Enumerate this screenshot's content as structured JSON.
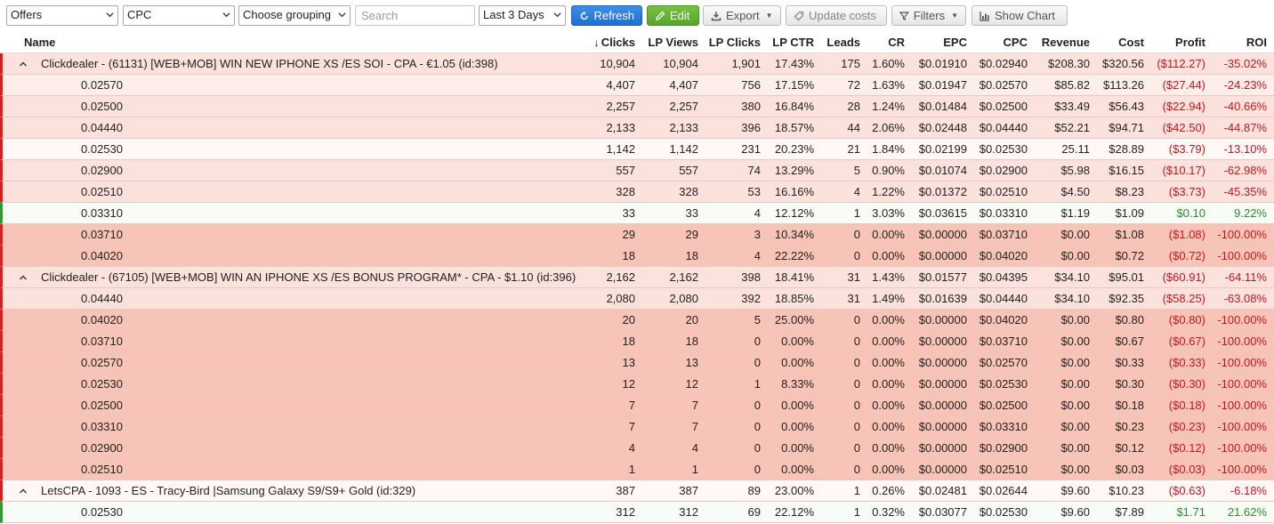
{
  "toolbar": {
    "entity_select": "Offers",
    "metric_select": "CPC",
    "grouping_select": "Choose grouping",
    "search_placeholder": "Search",
    "date_select": "Last 3 Days",
    "refresh_label": "Refresh",
    "edit_label": "Edit",
    "export_label": "Export",
    "update_costs_label": "Update costs",
    "filters_label": "Filters",
    "show_chart_label": "Show Chart"
  },
  "columns": {
    "name": "Name",
    "clicks": "Clicks",
    "lp_views": "LP Views",
    "lp_clicks": "LP Clicks",
    "lp_ctr": "LP CTR",
    "leads": "Leads",
    "cr": "CR",
    "epc": "EPC",
    "cpc": "CPC",
    "revenue": "Revenue",
    "cost": "Cost",
    "profit": "Profit",
    "roi": "ROI"
  },
  "sort_indicator": "↓",
  "colors": {
    "red_bar": "#d62020",
    "green_bar": "#2f9a2f",
    "loss_text": "#c4161c",
    "profit_text": "#2e8b2e",
    "refresh_blue": "#1e6fcf",
    "edit_green": "#56a52a"
  },
  "rows": [
    {
      "type": "group",
      "name": "Clickdealer - (61131) [WEB+MOB] WIN NEW IPHONE XS /ES SOI - CPA - €1.05 (id:398)",
      "clicks": "10,904",
      "lp_views": "10,904",
      "lp_clicks": "1,901",
      "lp_ctr": "17.43%",
      "leads": "175",
      "cr": "1.60%",
      "epc": "$0.01910",
      "cpc": "$0.02940",
      "revenue": "$208.30",
      "cost": "$320.56",
      "profit": "($112.27)",
      "roi": "-35.02%",
      "tone": "l1",
      "bar": "red",
      "sign": "neg"
    },
    {
      "type": "sub",
      "name": "0.02570",
      "clicks": "4,407",
      "lp_views": "4,407",
      "lp_clicks": "756",
      "lp_ctr": "17.15%",
      "leads": "72",
      "cr": "1.63%",
      "epc": "$0.01947",
      "cpc": "$0.02570",
      "revenue": "$85.82",
      "cost": "$113.26",
      "profit": "($27.44)",
      "roi": "-24.23%",
      "tone": "l2",
      "bar": "red",
      "sign": "neg"
    },
    {
      "type": "sub",
      "name": "0.02500",
      "clicks": "2,257",
      "lp_views": "2,257",
      "lp_clicks": "380",
      "lp_ctr": "16.84%",
      "leads": "28",
      "cr": "1.24%",
      "epc": "$0.01484",
      "cpc": "$0.02500",
      "revenue": "$33.49",
      "cost": "$56.43",
      "profit": "($22.94)",
      "roi": "-40.66%",
      "tone": "l1",
      "bar": "red",
      "sign": "neg"
    },
    {
      "type": "sub",
      "name": "0.04440",
      "clicks": "2,133",
      "lp_views": "2,133",
      "lp_clicks": "396",
      "lp_ctr": "18.57%",
      "leads": "44",
      "cr": "2.06%",
      "epc": "$0.02448",
      "cpc": "$0.04440",
      "revenue": "$52.21",
      "cost": "$94.71",
      "profit": "($42.50)",
      "roi": "-44.87%",
      "tone": "l1",
      "bar": "red",
      "sign": "neg"
    },
    {
      "type": "sub",
      "name": "0.02530",
      "clicks": "1,142",
      "lp_views": "1,142",
      "lp_clicks": "231",
      "lp_ctr": "20.23%",
      "leads": "21",
      "cr": "1.84%",
      "epc": "$0.02199",
      "cpc": "$0.02530",
      "revenue": "25.11",
      "cost": "$28.89",
      "profit": "($3.79)",
      "roi": "-13.10%",
      "tone": "l3",
      "bar": "red",
      "sign": "neg"
    },
    {
      "type": "sub",
      "name": "0.02900",
      "clicks": "557",
      "lp_views": "557",
      "lp_clicks": "74",
      "lp_ctr": "13.29%",
      "leads": "5",
      "cr": "0.90%",
      "epc": "$0.01074",
      "cpc": "$0.02900",
      "revenue": "$5.98",
      "cost": "$16.15",
      "profit": "($10.17)",
      "roi": "-62.98%",
      "tone": "l1",
      "bar": "red",
      "sign": "neg"
    },
    {
      "type": "sub",
      "name": "0.02510",
      "clicks": "328",
      "lp_views": "328",
      "lp_clicks": "53",
      "lp_ctr": "16.16%",
      "leads": "4",
      "cr": "1.22%",
      "epc": "$0.01372",
      "cpc": "$0.02510",
      "revenue": "$4.50",
      "cost": "$8.23",
      "profit": "($3.73)",
      "roi": "-45.35%",
      "tone": "l1",
      "bar": "red",
      "sign": "neg"
    },
    {
      "type": "sub",
      "name": "0.03310",
      "clicks": "33",
      "lp_views": "33",
      "lp_clicks": "4",
      "lp_ctr": "12.12%",
      "leads": "1",
      "cr": "3.03%",
      "epc": "$0.03615",
      "cpc": "$0.03310",
      "revenue": "$1.19",
      "cost": "$1.09",
      "profit": "$0.10",
      "roi": "9.22%",
      "tone": "green",
      "bar": "green",
      "sign": "pos"
    },
    {
      "type": "sub",
      "name": "0.03710",
      "clicks": "29",
      "lp_views": "29",
      "lp_clicks": "3",
      "lp_ctr": "10.34%",
      "leads": "0",
      "cr": "0.00%",
      "epc": "$0.00000",
      "cpc": "$0.03710",
      "revenue": "$0.00",
      "cost": "$1.08",
      "profit": "($1.08)",
      "roi": "-100.00%",
      "tone": "red",
      "bar": "red",
      "sign": "neg"
    },
    {
      "type": "sub",
      "name": "0.04020",
      "clicks": "18",
      "lp_views": "18",
      "lp_clicks": "4",
      "lp_ctr": "22.22%",
      "leads": "0",
      "cr": "0.00%",
      "epc": "$0.00000",
      "cpc": "$0.04020",
      "revenue": "$0.00",
      "cost": "$0.72",
      "profit": "($0.72)",
      "roi": "-100.00%",
      "tone": "red",
      "bar": "red",
      "sign": "neg"
    },
    {
      "type": "group",
      "name": "Clickdealer - (67105) [WEB+MOB] WIN AN IPHONE XS /ES BONUS PROGRAM* - CPA - $1.10 (id:396)",
      "clicks": "2,162",
      "lp_views": "2,162",
      "lp_clicks": "398",
      "lp_ctr": "18.41%",
      "leads": "31",
      "cr": "1.43%",
      "epc": "$0.01577",
      "cpc": "$0.04395",
      "revenue": "$34.10",
      "cost": "$95.01",
      "profit": "($60.91)",
      "roi": "-64.11%",
      "tone": "l1",
      "bar": "red",
      "sign": "neg"
    },
    {
      "type": "sub",
      "name": "0.04440",
      "clicks": "2,080",
      "lp_views": "2,080",
      "lp_clicks": "392",
      "lp_ctr": "18.85%",
      "leads": "31",
      "cr": "1.49%",
      "epc": "$0.01639",
      "cpc": "$0.04440",
      "revenue": "$34.10",
      "cost": "$92.35",
      "profit": "($58.25)",
      "roi": "-63.08%",
      "tone": "l1",
      "bar": "red",
      "sign": "neg"
    },
    {
      "type": "sub",
      "name": "0.04020",
      "clicks": "20",
      "lp_views": "20",
      "lp_clicks": "5",
      "lp_ctr": "25.00%",
      "leads": "0",
      "cr": "0.00%",
      "epc": "$0.00000",
      "cpc": "$0.04020",
      "revenue": "$0.00",
      "cost": "$0.80",
      "profit": "($0.80)",
      "roi": "-100.00%",
      "tone": "red",
      "bar": "red",
      "sign": "neg"
    },
    {
      "type": "sub",
      "name": "0.03710",
      "clicks": "18",
      "lp_views": "18",
      "lp_clicks": "0",
      "lp_ctr": "0.00%",
      "leads": "0",
      "cr": "0.00%",
      "epc": "$0.00000",
      "cpc": "$0.03710",
      "revenue": "$0.00",
      "cost": "$0.67",
      "profit": "($0.67)",
      "roi": "-100.00%",
      "tone": "red",
      "bar": "red",
      "sign": "neg"
    },
    {
      "type": "sub",
      "name": "0.02570",
      "clicks": "13",
      "lp_views": "13",
      "lp_clicks": "0",
      "lp_ctr": "0.00%",
      "leads": "0",
      "cr": "0.00%",
      "epc": "$0.00000",
      "cpc": "$0.02570",
      "revenue": "$0.00",
      "cost": "$0.33",
      "profit": "($0.33)",
      "roi": "-100.00%",
      "tone": "red",
      "bar": "red",
      "sign": "neg"
    },
    {
      "type": "sub",
      "name": "0.02530",
      "clicks": "12",
      "lp_views": "12",
      "lp_clicks": "1",
      "lp_ctr": "8.33%",
      "leads": "0",
      "cr": "0.00%",
      "epc": "$0.00000",
      "cpc": "$0.02530",
      "revenue": "$0.00",
      "cost": "$0.30",
      "profit": "($0.30)",
      "roi": "-100.00%",
      "tone": "red",
      "bar": "red",
      "sign": "neg"
    },
    {
      "type": "sub",
      "name": "0.02500",
      "clicks": "7",
      "lp_views": "7",
      "lp_clicks": "0",
      "lp_ctr": "0.00%",
      "leads": "0",
      "cr": "0.00%",
      "epc": "$0.00000",
      "cpc": "$0.02500",
      "revenue": "$0.00",
      "cost": "$0.18",
      "profit": "($0.18)",
      "roi": "-100.00%",
      "tone": "red",
      "bar": "red",
      "sign": "neg"
    },
    {
      "type": "sub",
      "name": "0.03310",
      "clicks": "7",
      "lp_views": "7",
      "lp_clicks": "0",
      "lp_ctr": "0.00%",
      "leads": "0",
      "cr": "0.00%",
      "epc": "$0.00000",
      "cpc": "$0.03310",
      "revenue": "$0.00",
      "cost": "$0.23",
      "profit": "($0.23)",
      "roi": "-100.00%",
      "tone": "red",
      "bar": "red",
      "sign": "neg"
    },
    {
      "type": "sub",
      "name": "0.02900",
      "clicks": "4",
      "lp_views": "4",
      "lp_clicks": "0",
      "lp_ctr": "0.00%",
      "leads": "0",
      "cr": "0.00%",
      "epc": "$0.00000",
      "cpc": "$0.02900",
      "revenue": "$0.00",
      "cost": "$0.12",
      "profit": "($0.12)",
      "roi": "-100.00%",
      "tone": "red",
      "bar": "red",
      "sign": "neg"
    },
    {
      "type": "sub",
      "name": "0.02510",
      "clicks": "1",
      "lp_views": "1",
      "lp_clicks": "0",
      "lp_ctr": "0.00%",
      "leads": "0",
      "cr": "0.00%",
      "epc": "$0.00000",
      "cpc": "$0.02510",
      "revenue": "$0.00",
      "cost": "$0.03",
      "profit": "($0.03)",
      "roi": "-100.00%",
      "tone": "red",
      "bar": "red",
      "sign": "neg"
    },
    {
      "type": "group",
      "name": "LetsCPA - 1093 - ES - Tracy-Bird |Samsung Galaxy S9/S9+ Gold (id:329)",
      "clicks": "387",
      "lp_views": "387",
      "lp_clicks": "89",
      "lp_ctr": "23.00%",
      "leads": "1",
      "cr": "0.26%",
      "epc": "$0.02481",
      "cpc": "$0.02644",
      "revenue": "$9.60",
      "cost": "$10.23",
      "profit": "($0.63)",
      "roi": "-6.18%",
      "tone": "l3",
      "bar": "red",
      "sign": "neg"
    },
    {
      "type": "sub",
      "name": "0.02530",
      "clicks": "312",
      "lp_views": "312",
      "lp_clicks": "69",
      "lp_ctr": "22.12%",
      "leads": "1",
      "cr": "0.32%",
      "epc": "$0.03077",
      "cpc": "$0.02530",
      "revenue": "$9.60",
      "cost": "$7.89",
      "profit": "$1.71",
      "roi": "21.62%",
      "tone": "green",
      "bar": "green",
      "sign": "pos"
    }
  ]
}
